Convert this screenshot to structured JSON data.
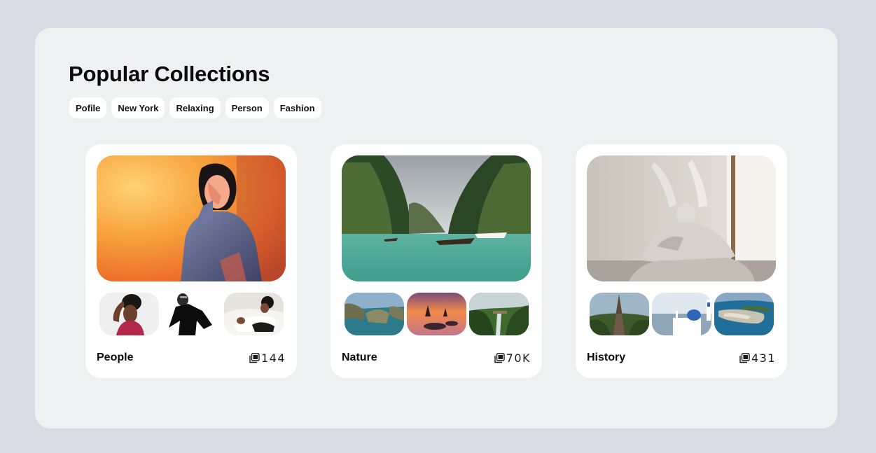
{
  "page": {
    "title": "Popular Collections"
  },
  "tags": [
    {
      "label": "Pofile"
    },
    {
      "label": "New York"
    },
    {
      "label": "Relaxing"
    },
    {
      "label": "Person"
    },
    {
      "label": "Fashion"
    }
  ],
  "collections": [
    {
      "name": "People",
      "count": "144",
      "count_icon": "stack-icon"
    },
    {
      "name": "Nature",
      "count": "70K",
      "count_icon": "stack-icon"
    },
    {
      "name": "History",
      "count": "431",
      "count_icon": "stack-icon"
    }
  ],
  "colors": {
    "page_background": "#d9dae3",
    "panel_background": "#eff0f2",
    "card_background": "#ffffff",
    "text": "#0b0b0f"
  }
}
